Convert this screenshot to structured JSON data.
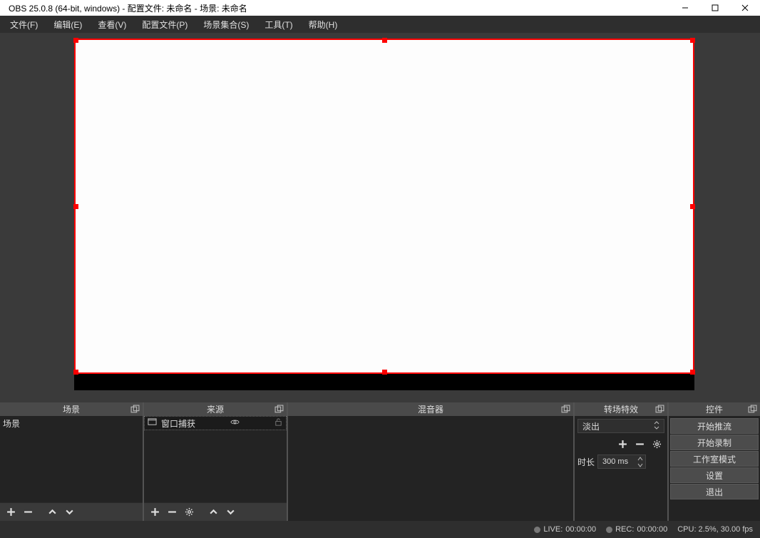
{
  "titlebar": {
    "title": "OBS 25.0.8 (64-bit, windows) - 配置文件: 未命名 - 场景: 未命名"
  },
  "menu": {
    "file": "文件(F)",
    "edit": "编辑(E)",
    "view": "查看(V)",
    "profile": "配置文件(P)",
    "scene_collection": "场景集合(S)",
    "tools": "工具(T)",
    "help": "帮助(H)"
  },
  "docks": {
    "scenes": {
      "title": "场景",
      "items": [
        "场景"
      ]
    },
    "sources": {
      "title": "来源",
      "items": [
        {
          "label": "窗口捕获"
        }
      ]
    },
    "mixer": {
      "title": "混音器"
    },
    "transitions": {
      "title": "转场特效",
      "selected": "淡出",
      "duration_label": "时长",
      "duration_value": "300 ms"
    },
    "controls": {
      "title": "控件",
      "start_stream": "开始推流",
      "start_record": "开始录制",
      "studio_mode": "工作室模式",
      "settings": "设置",
      "exit": "退出"
    }
  },
  "status": {
    "live_label": "LIVE:",
    "live_time": "00:00:00",
    "rec_label": "REC:",
    "rec_time": "00:00:00",
    "cpu": "CPU: 2.5%, 30.00 fps"
  }
}
